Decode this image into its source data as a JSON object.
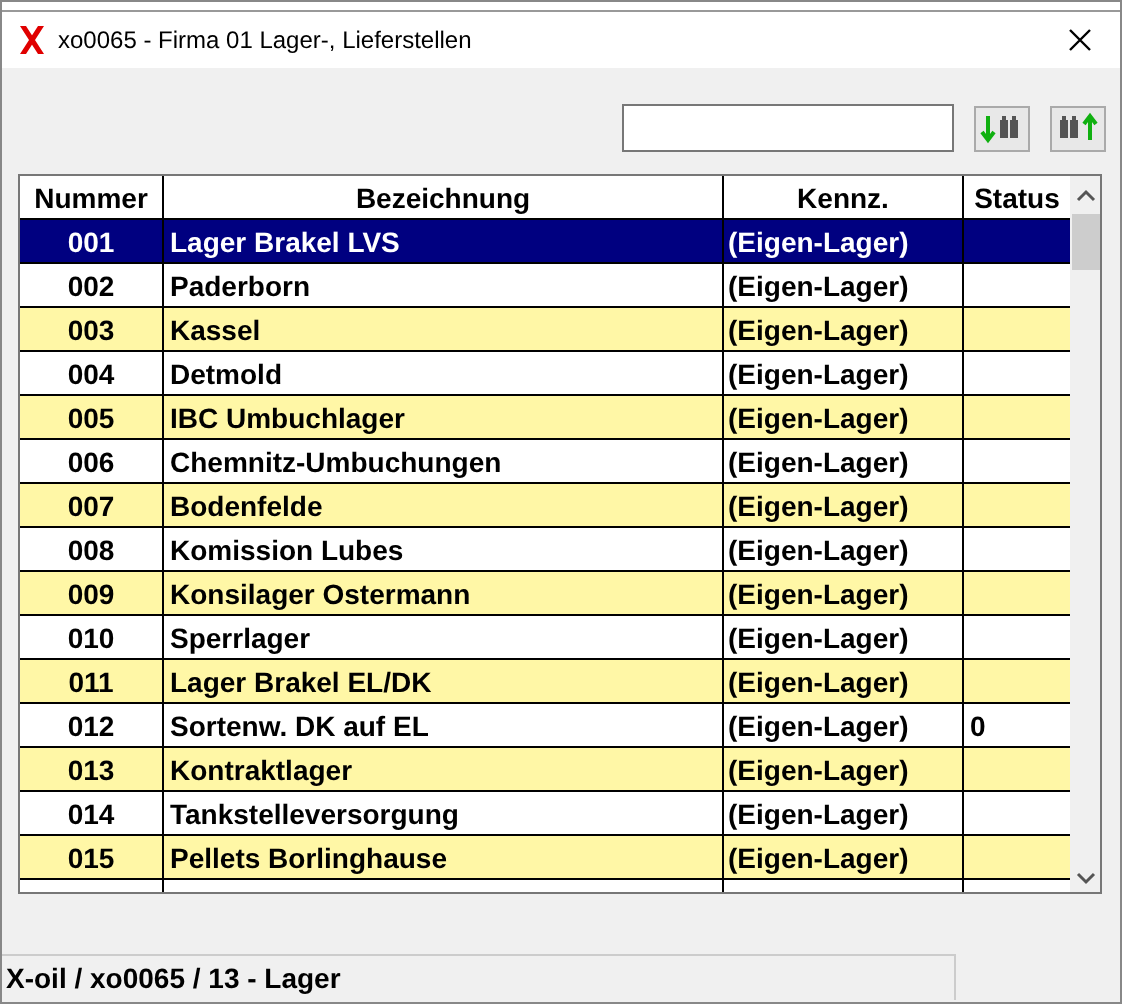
{
  "window": {
    "title": "xo0065 - Firma 01 Lager-, Lieferstellen"
  },
  "table": {
    "columns": [
      "Nummer",
      "Bezeichnung",
      "Kennz.",
      "Status"
    ],
    "rows": [
      {
        "cells": [
          "001",
          "Lager Brakel LVS",
          "(Eigen-Lager)",
          ""
        ],
        "selected": true
      },
      {
        "cells": [
          "002",
          "Paderborn",
          "(Eigen-Lager)",
          ""
        ],
        "selected": false
      },
      {
        "cells": [
          "003",
          "Kassel",
          "(Eigen-Lager)",
          ""
        ],
        "selected": false
      },
      {
        "cells": [
          "004",
          "Detmold",
          "(Eigen-Lager)",
          ""
        ],
        "selected": false
      },
      {
        "cells": [
          "005",
          "IBC Umbuchlager",
          "(Eigen-Lager)",
          ""
        ],
        "selected": false
      },
      {
        "cells": [
          "006",
          "Chemnitz-Umbuchungen",
          "(Eigen-Lager)",
          ""
        ],
        "selected": false
      },
      {
        "cells": [
          "007",
          "Bodenfelde",
          "(Eigen-Lager)",
          ""
        ],
        "selected": false
      },
      {
        "cells": [
          "008",
          "Komission Lubes",
          "(Eigen-Lager)",
          ""
        ],
        "selected": false
      },
      {
        "cells": [
          "009",
          "Konsilager Ostermann",
          "(Eigen-Lager)",
          ""
        ],
        "selected": false
      },
      {
        "cells": [
          "010",
          "Sperrlager",
          "(Eigen-Lager)",
          ""
        ],
        "selected": false
      },
      {
        "cells": [
          "011",
          "Lager Brakel EL/DK",
          "(Eigen-Lager)",
          ""
        ],
        "selected": false
      },
      {
        "cells": [
          "012",
          "Sortenw. DK auf EL",
          "(Eigen-Lager)",
          "0"
        ],
        "selected": false
      },
      {
        "cells": [
          "013",
          "Kontraktlager",
          "(Eigen-Lager)",
          ""
        ],
        "selected": false
      },
      {
        "cells": [
          "014",
          "Tankstelleversorgung",
          "(Eigen-Lager)",
          ""
        ],
        "selected": false
      },
      {
        "cells": [
          "015",
          "Pellets Borlinghause",
          "(Eigen-Lager)",
          ""
        ],
        "selected": false
      }
    ]
  },
  "status_bar": "X-oil / xo0065 / 13 - Lager"
}
